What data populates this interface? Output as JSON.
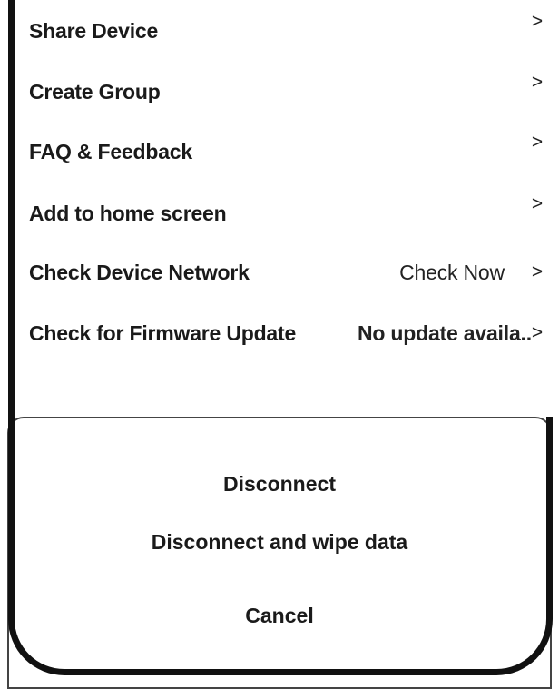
{
  "menu": {
    "items": [
      {
        "label": "Share Device",
        "value": "",
        "chevron": ">"
      },
      {
        "label": "Create Group",
        "value": "",
        "chevron": ">"
      },
      {
        "label": "FAQ & Feedback",
        "value": "",
        "chevron": ">"
      },
      {
        "label": "Add to home screen",
        "value": "",
        "chevron": ">"
      },
      {
        "label": "Check Device Network",
        "value": "Check Now",
        "chevron": ">"
      },
      {
        "label": "Check for Firmware Update",
        "value": "No update availa..",
        "chevron": ">"
      }
    ]
  },
  "action_sheet": {
    "disconnect_label": "Disconnect",
    "wipe_label": "Disconnect and wipe data",
    "cancel_label": "Cancel"
  }
}
